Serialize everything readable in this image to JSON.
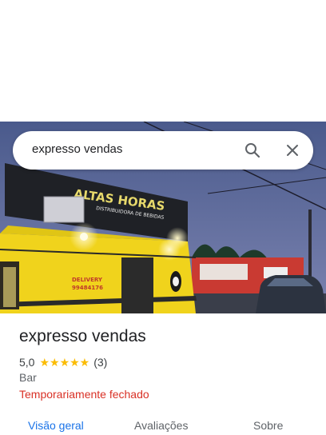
{
  "search": {
    "query": "expresso vendas"
  },
  "photo": {
    "sign_main": "ALTAS HORAS",
    "sign_sub": "DISTRIBUIDORA DE BEBIDAS",
    "delivery_label": "DELIVERY",
    "delivery_phone": "99484176"
  },
  "place": {
    "name": "expresso vendas",
    "rating": "5,0",
    "stars": "★★★★★",
    "review_count": "(3)",
    "category": "Bar",
    "status": "Temporariamente fechado"
  },
  "tabs": [
    {
      "label": "Visão geral",
      "active": true
    },
    {
      "label": "Avaliações"
    },
    {
      "label": "Sobre"
    }
  ],
  "colors": {
    "accent": "#1a73e8",
    "closed": "#d93025",
    "star": "#fbbc04"
  }
}
